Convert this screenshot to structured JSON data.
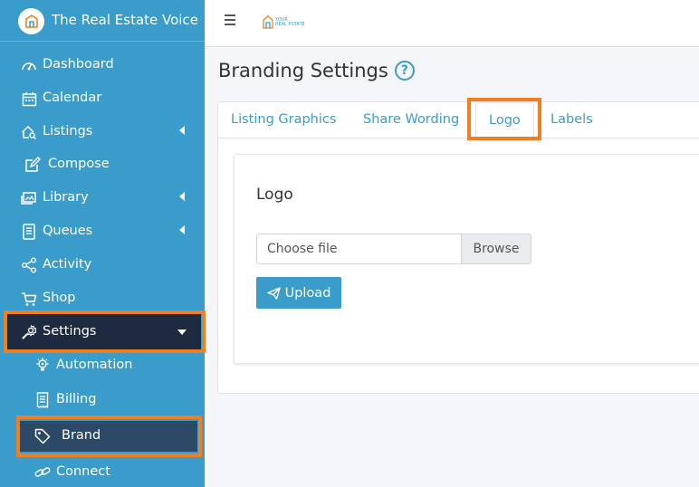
{
  "app": {
    "title": "The Real Estate Voice"
  },
  "sidebar": {
    "items": [
      {
        "label": "Dashboard",
        "icon": "dashboard-icon"
      },
      {
        "label": "Calendar",
        "icon": "calendar-icon"
      },
      {
        "label": "Listings",
        "icon": "house-search-icon",
        "expandable": true
      },
      {
        "label": "Compose",
        "icon": "edit-icon"
      },
      {
        "label": "Library",
        "icon": "images-icon",
        "expandable": true
      },
      {
        "label": "Queues",
        "icon": "queue-icon",
        "expandable": true
      },
      {
        "label": "Activity",
        "icon": "share-icon"
      },
      {
        "label": "Shop",
        "icon": "cart-icon"
      },
      {
        "label": "Settings",
        "icon": "settings-icon",
        "expanded": true,
        "active": true
      }
    ],
    "settings_sub": [
      {
        "label": "Automation",
        "icon": "lightbulb-gear-icon"
      },
      {
        "label": "Billing",
        "icon": "receipt-icon"
      },
      {
        "label": "Brand",
        "icon": "tag-icon",
        "active": true
      },
      {
        "label": "Connect",
        "icon": "link-icon"
      }
    ]
  },
  "topbar": {
    "logo_text_1": "YOUR",
    "logo_text_2": "REAL ESTATE"
  },
  "page": {
    "title": "Branding Settings"
  },
  "tabs": [
    {
      "label": "Listing Graphics"
    },
    {
      "label": "Share Wording"
    },
    {
      "label": "Logo",
      "active": true
    },
    {
      "label": "Labels"
    }
  ],
  "logo_section": {
    "title": "Logo",
    "file_placeholder": "Choose file",
    "browse_label": "Browse",
    "upload_label": "Upload"
  },
  "colors": {
    "sidebar": "#3a9ccb",
    "active": "#1e2a3f",
    "highlight": "#f07f24",
    "accent": "#3a9ccb"
  }
}
